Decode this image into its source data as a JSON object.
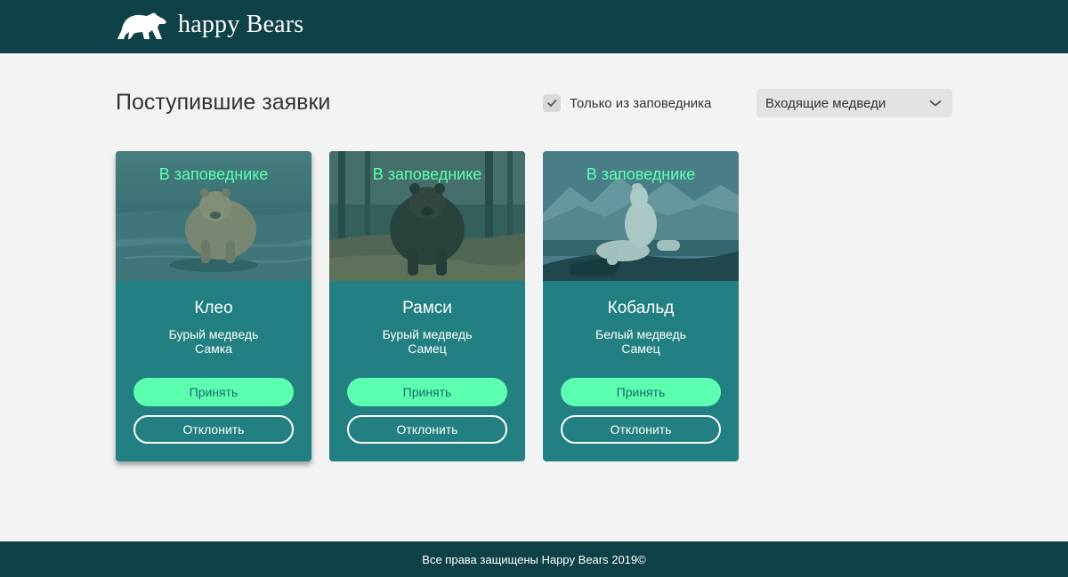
{
  "header": {
    "logo_icon": "bear-icon",
    "brand": "happy Bears"
  },
  "main": {
    "title": "Поступившие заявки",
    "filter": {
      "label": "Только из заповедника",
      "checked": true
    },
    "select": {
      "value": "Входящие медведи",
      "icon": "chevron-down-icon"
    }
  },
  "cards": [
    {
      "status": "В заповеднике",
      "name": "Клео",
      "species": "Бурый медведь",
      "sex": "Самка",
      "accept": "Принять",
      "decline": "Отклонить"
    },
    {
      "status": "В заповеднике",
      "name": "Рамси",
      "species": "Бурый медведь",
      "sex": "Самец",
      "accept": "Принять",
      "decline": "Отклонить"
    },
    {
      "status": "В заповеднике",
      "name": "Кобальд",
      "species": "Белый медведь",
      "sex": "Самец",
      "accept": "Принять",
      "decline": "Отклонить"
    }
  ],
  "footer": {
    "text": "Все права защищены Happy Bears 2019©"
  },
  "colors": {
    "header": "#0f4248",
    "card": "#227f82",
    "accent": "#5cffb0",
    "background": "#f3f3f3"
  }
}
